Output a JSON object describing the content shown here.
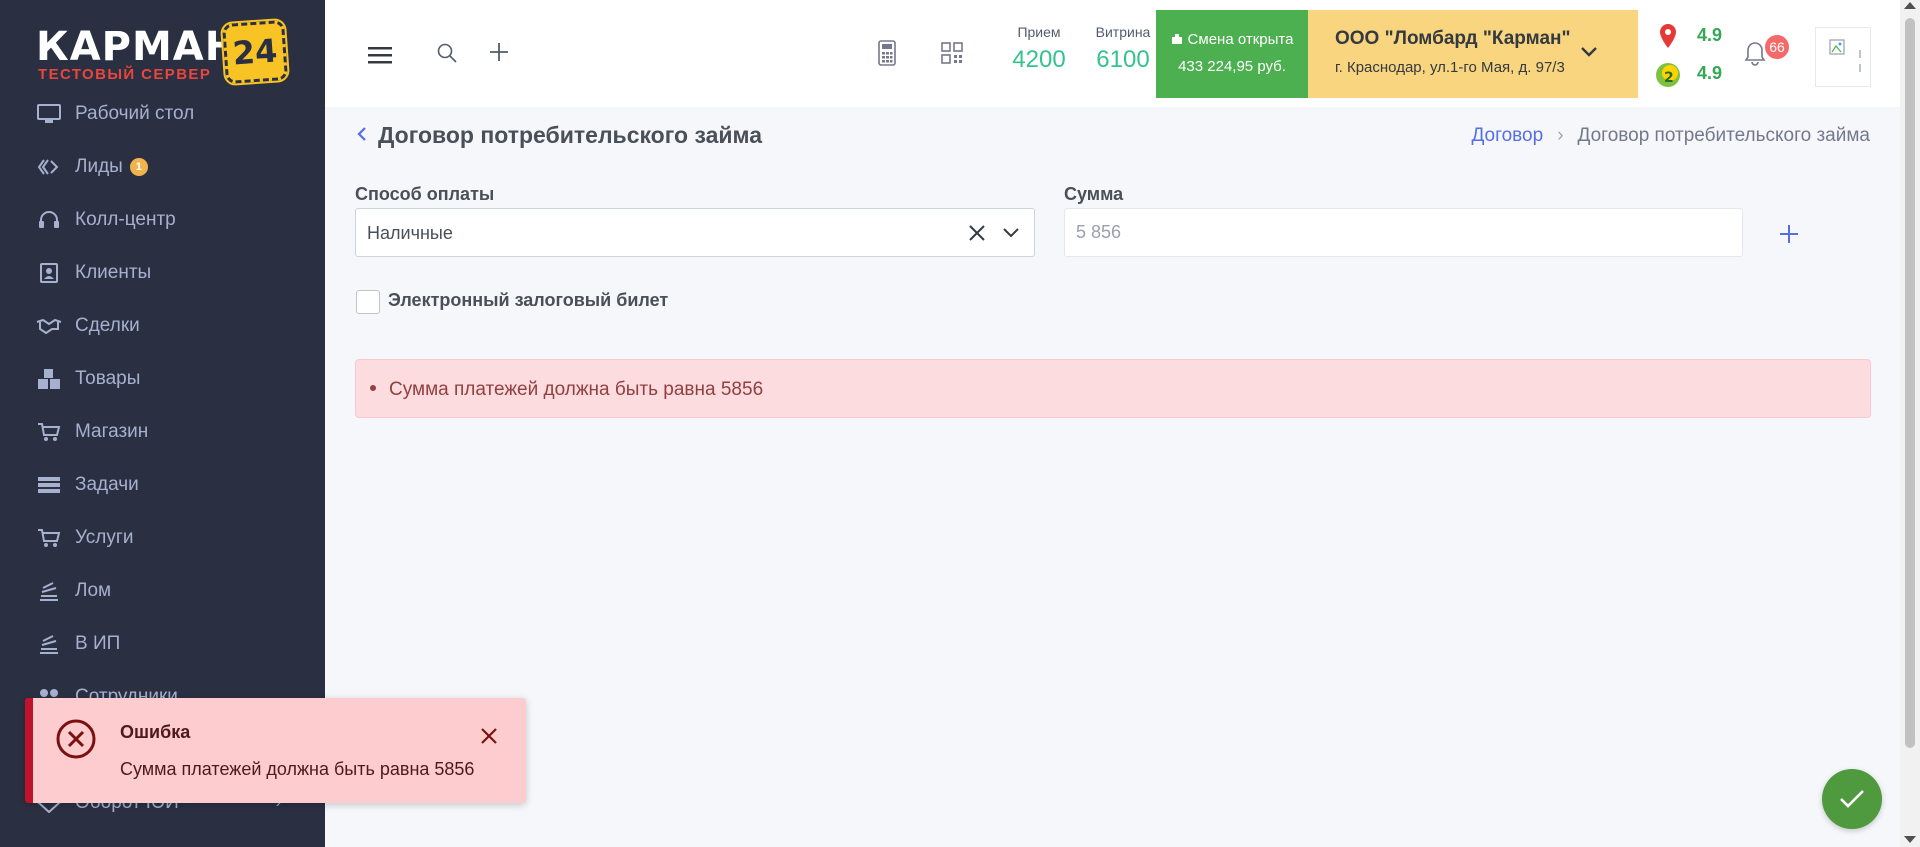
{
  "logo": {
    "word": "КАРМАН",
    "badge": "24",
    "subtitle": "ТЕСТОВЫЙ СЕРВЕР"
  },
  "sidebar": {
    "items": [
      {
        "label": "Рабочий стол",
        "icon": "desktop-icon"
      },
      {
        "label": "Лиды",
        "icon": "diamond-icon",
        "count": "1"
      },
      {
        "label": "Колл-центр",
        "icon": "headset-icon"
      },
      {
        "label": "Клиенты",
        "icon": "contact-card-icon"
      },
      {
        "label": "Сделки",
        "icon": "handshake-icon"
      },
      {
        "label": "Товары",
        "icon": "boxes-icon"
      },
      {
        "label": "Магазин",
        "icon": "cart-icon"
      },
      {
        "label": "Задачи",
        "icon": "tasks-icon"
      },
      {
        "label": "Услуги",
        "icon": "cart-icon"
      },
      {
        "label": "Лом",
        "icon": "stack-icon"
      },
      {
        "label": "В ИП",
        "icon": "stack-icon"
      },
      {
        "label": "Сотрудники",
        "icon": "users-icon"
      },
      {
        "label": "",
        "icon": "chart-icon",
        "has_chevron": true
      },
      {
        "label": "Оборот ЮИ",
        "icon": "diamond-icon",
        "has_chevron": true
      }
    ]
  },
  "header": {
    "stats": [
      {
        "label": "Прием",
        "value": "4200"
      },
      {
        "label": "Витрина",
        "value": "6100"
      }
    ],
    "shift": {
      "title": "Смена открыта",
      "amount": "433 224,95 руб."
    },
    "company": {
      "name": "ООО \"Ломбард \"Карман\"",
      "address": "г. Краснодар, ул.1-го Мая, д. 97/3"
    },
    "ratings": [
      "4.9",
      "4.9"
    ],
    "notifications_count": "66"
  },
  "page": {
    "title": "Договор потребительского займа",
    "breadcrumb": {
      "link": "Договор",
      "current": "Договор потребительского займа"
    }
  },
  "form": {
    "payment_label": "Способ оплаты",
    "payment_value": "Наличные",
    "sum_label": "Сумма",
    "sum_placeholder": "5 856",
    "checkbox_label": "Электронный залоговый билет",
    "checkbox_checked": false
  },
  "alert": {
    "message": "Сумма платежей должна быть равна 5856"
  },
  "toast": {
    "title": "Ошибка",
    "message": "Сумма платежей должна быть равна 5856"
  },
  "colors": {
    "sidebar_bg": "#2a3042",
    "shift_green": "#4caf50",
    "company_yellow": "#f8d57e",
    "accent_green": "#34c38f",
    "error_red": "#c0122c",
    "link_blue": "#556ee6"
  }
}
